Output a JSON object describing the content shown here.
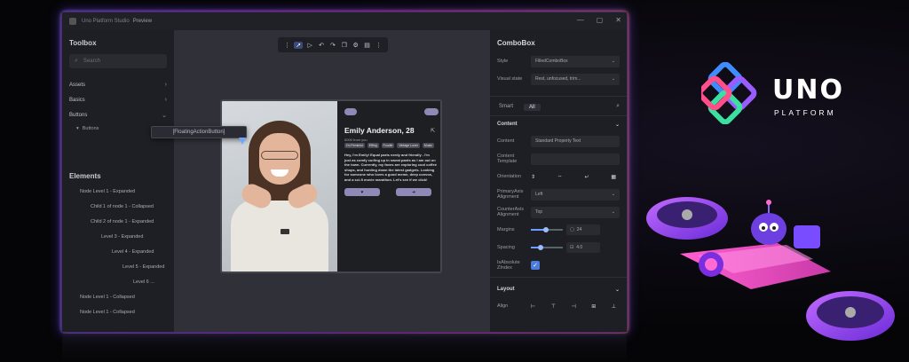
{
  "window": {
    "title": "Uno Platform Studio",
    "document": "Preview",
    "controls": [
      "—",
      "▢",
      "✕"
    ]
  },
  "toolbox": {
    "title": "Toolbox",
    "search_placeholder": "Search",
    "categories": [
      {
        "label": "Assets"
      },
      {
        "label": "Basics"
      },
      {
        "label": "Buttons"
      }
    ],
    "sub_item": "Buttons",
    "dragged_item": "[FloatingActionButton]"
  },
  "elements": {
    "title": "Elements",
    "nodes": [
      {
        "label": "Node Level 1 - Expanded",
        "indent": 1
      },
      {
        "label": "Child 1 of node 1 - Collapsed",
        "indent": 2
      },
      {
        "label": "Child 2 of node 1 - Expanded",
        "indent": 2
      },
      {
        "label": "Level 3 - Expanded",
        "indent": 3
      },
      {
        "label": "Level 4 - Expanded",
        "indent": 4
      },
      {
        "label": "Level 5 - Expanded",
        "indent": 5
      },
      {
        "label": "Level 6 ...",
        "indent": 6
      },
      {
        "label": "Node Level 1 - Collapsed",
        "indent": 1
      },
      {
        "label": "Node Level 1 - Collapsed",
        "indent": 1
      }
    ]
  },
  "canvas_toolbar": {
    "icons": [
      "grip-icon",
      "pointer-icon",
      "play-icon",
      "undo-icon",
      "redo-icon",
      "copy-icon",
      "settings-icon",
      "layers-icon",
      "more-icon"
    ]
  },
  "profile": {
    "name": "Emily Anderson, 28",
    "subline": "5000 from you",
    "tags": [
      "I'm Feminist",
      "Effing",
      "Foodie",
      "Vintage Lover",
      "Music"
    ],
    "bio": "Hey, I'm Emily! Equal parts nerdy and friendly - I'm just as comfy curling up in sweat pants as I am out on the town. Currently, my faves are exploring cool coffee shops, and hunting down the latest gadgets. Looking for someone who loves a good meme, deep convos, and a sci-fi movie marathon. Let's see if we click!"
  },
  "properties": {
    "title": "ComboBox",
    "style_label": "Style",
    "style_value": "FilledComboBox",
    "visual_label": "Visual state",
    "visual_value": "Rest, unfocused, trim...",
    "tab_smart": "Smart",
    "tab_all": "All",
    "section_content": "Content",
    "content_label": "Content",
    "content_value": "Standard Property Text",
    "template_label": "Content Template",
    "orientation_label": "Orientation",
    "primary_label": "PrimaryAxis Alignment",
    "primary_value": "Left",
    "counter_label": "CounterAxis Alignment",
    "counter_value": "Top",
    "margins_label": "Margins",
    "margins_value": "24",
    "spacing_label": "Spacing",
    "spacing_value": "4.0",
    "zindex_label": "IsAbsolute ZIndex",
    "section_layout": "Layout",
    "align_label": "Align"
  },
  "brand": {
    "word": "UNO",
    "sub": "PLATFORM",
    "colors": {
      "blue": "#3f8cff",
      "purple": "#9b5cff",
      "pink": "#ff4f8a",
      "green": "#3be0a0"
    }
  }
}
